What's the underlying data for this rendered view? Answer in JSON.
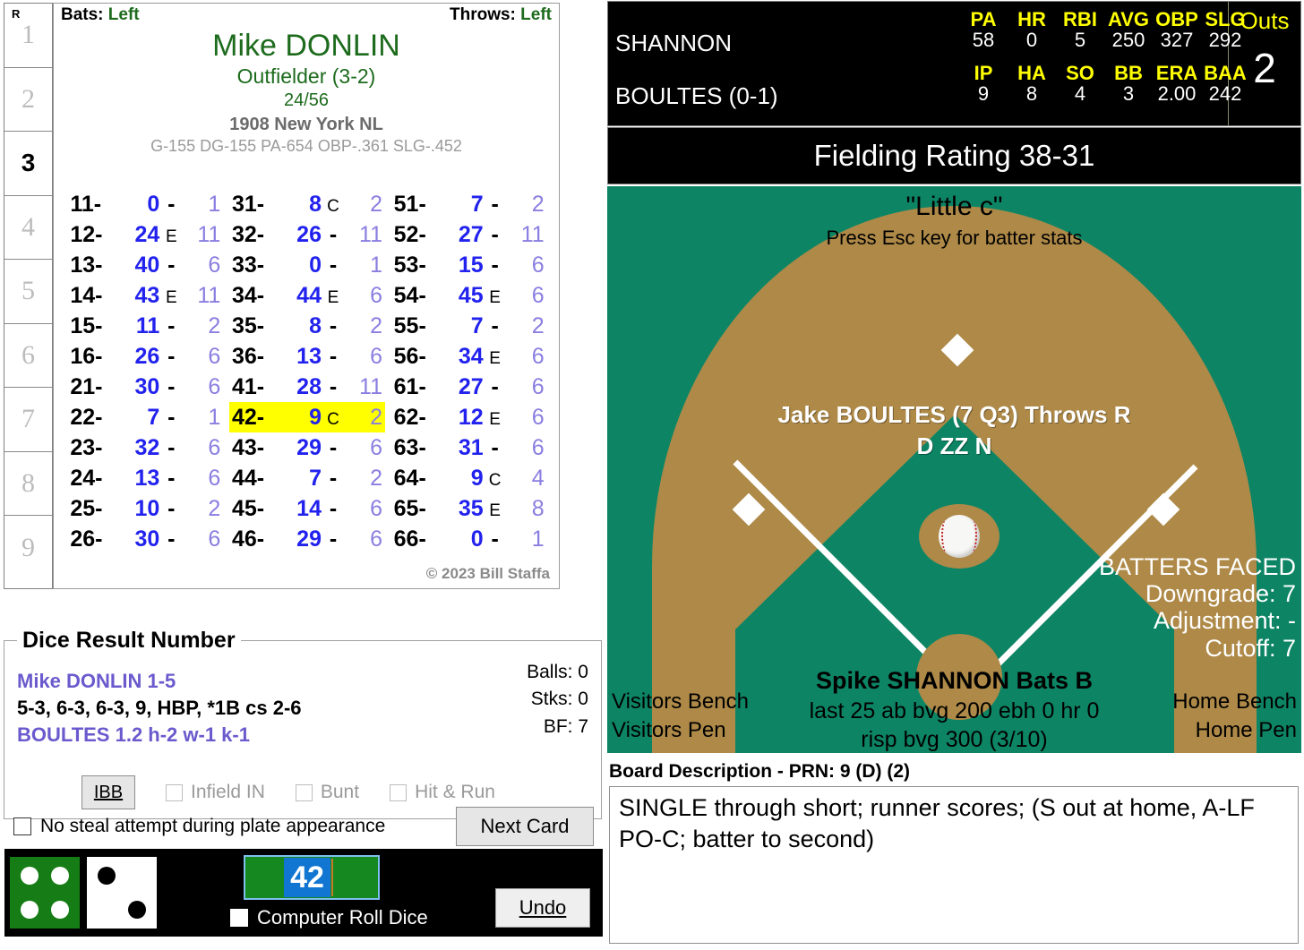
{
  "innings": {
    "runs_header": "R",
    "cells": [
      "1",
      "2",
      "3",
      "4",
      "5",
      "6",
      "7",
      "8",
      "9"
    ],
    "current": "3"
  },
  "batter_card": {
    "bats_label": "Bats:",
    "bats_value": "Left",
    "throws_label": "Throws:",
    "throws_value": "Left",
    "player_name": "Mike DONLIN",
    "position": "Outfielder (3-2)",
    "ratio": "24/56",
    "team": "1908 New York NL",
    "stat_line": "G-155 DG-155 PA-654 OBP-.361 SLG-.452",
    "copyright": "© 2023 Bill Staffa",
    "columns": [
      [
        {
          "key": "11-",
          "num": "0",
          "mid": "-",
          "last": "1",
          "hl": false
        },
        {
          "key": "12-",
          "num": "24",
          "mid": "E",
          "last": "11",
          "hl": false
        },
        {
          "key": "13-",
          "num": "40",
          "mid": "-",
          "last": "6",
          "hl": false
        },
        {
          "key": "14-",
          "num": "43",
          "mid": "E",
          "last": "11",
          "hl": false
        },
        {
          "key": "15-",
          "num": "11",
          "mid": "-",
          "last": "2",
          "hl": false
        },
        {
          "key": "16-",
          "num": "26",
          "mid": "-",
          "last": "6",
          "hl": false
        },
        {
          "key": "21-",
          "num": "30",
          "mid": "-",
          "last": "6",
          "hl": false
        },
        {
          "key": "22-",
          "num": "7",
          "mid": "-",
          "last": "1",
          "hl": false
        },
        {
          "key": "23-",
          "num": "32",
          "mid": "-",
          "last": "6",
          "hl": false
        },
        {
          "key": "24-",
          "num": "13",
          "mid": "-",
          "last": "6",
          "hl": false
        },
        {
          "key": "25-",
          "num": "10",
          "mid": "-",
          "last": "2",
          "hl": false
        },
        {
          "key": "26-",
          "num": "30",
          "mid": "-",
          "last": "6",
          "hl": false
        }
      ],
      [
        {
          "key": "31-",
          "num": "8",
          "mid": "C",
          "last": "2",
          "hl": false
        },
        {
          "key": "32-",
          "num": "26",
          "mid": "-",
          "last": "11",
          "hl": false
        },
        {
          "key": "33-",
          "num": "0",
          "mid": "-",
          "last": "1",
          "hl": false
        },
        {
          "key": "34-",
          "num": "44",
          "mid": "E",
          "last": "6",
          "hl": false
        },
        {
          "key": "35-",
          "num": "8",
          "mid": "-",
          "last": "2",
          "hl": false
        },
        {
          "key": "36-",
          "num": "13",
          "mid": "-",
          "last": "6",
          "hl": false
        },
        {
          "key": "41-",
          "num": "28",
          "mid": "-",
          "last": "11",
          "hl": false
        },
        {
          "key": "42-",
          "num": "9",
          "mid": "C",
          "last": "2",
          "hl": true
        },
        {
          "key": "43-",
          "num": "29",
          "mid": "-",
          "last": "6",
          "hl": false
        },
        {
          "key": "44-",
          "num": "7",
          "mid": "-",
          "last": "2",
          "hl": false
        },
        {
          "key": "45-",
          "num": "14",
          "mid": "-",
          "last": "6",
          "hl": false
        },
        {
          "key": "46-",
          "num": "29",
          "mid": "-",
          "last": "6",
          "hl": false
        }
      ],
      [
        {
          "key": "51-",
          "num": "7",
          "mid": "-",
          "last": "2",
          "hl": false
        },
        {
          "key": "52-",
          "num": "27",
          "mid": "-",
          "last": "11",
          "hl": false
        },
        {
          "key": "53-",
          "num": "15",
          "mid": "-",
          "last": "6",
          "hl": false
        },
        {
          "key": "54-",
          "num": "45",
          "mid": "E",
          "last": "6",
          "hl": false
        },
        {
          "key": "55-",
          "num": "7",
          "mid": "-",
          "last": "2",
          "hl": false
        },
        {
          "key": "56-",
          "num": "34",
          "mid": "E",
          "last": "6",
          "hl": false
        },
        {
          "key": "61-",
          "num": "27",
          "mid": "-",
          "last": "6",
          "hl": false
        },
        {
          "key": "62-",
          "num": "12",
          "mid": "E",
          "last": "6",
          "hl": false
        },
        {
          "key": "63-",
          "num": "31",
          "mid": "-",
          "last": "6",
          "hl": false
        },
        {
          "key": "64-",
          "num": "9",
          "mid": "C",
          "last": "4",
          "hl": false
        },
        {
          "key": "65-",
          "num": "35",
          "mid": "E",
          "last": "8",
          "hl": false
        },
        {
          "key": "66-",
          "num": "0",
          "mid": "-",
          "last": "1",
          "hl": false
        }
      ]
    ]
  },
  "dice_result": {
    "group_title": "Dice Result Number",
    "line1": "Mike DONLIN  1-5",
    "line2": "5-3, 6-3, 6-3, 9, HBP, *1B cs 2-6",
    "line3": "BOULTES  1.2  h-2  w-1  k-1",
    "balls": "Balls: 0",
    "strikes": "Stks: 0",
    "bf": "BF: 7",
    "ibb_label": "IBB",
    "infield_in_label": "Infield IN",
    "bunt_label": "Bunt",
    "hit_and_run_label": "Hit & Run",
    "no_steal_label": "No steal attempt during plate appearance",
    "next_card_label": "Next Card",
    "infield_in_checked": false,
    "bunt_checked": false,
    "hit_and_run_checked": false,
    "no_steal_checked": false
  },
  "dice_widget": {
    "green_die_value": 4,
    "white_die_value": 2,
    "roll_value": "42",
    "computer_roll_label": "Computer Roll Dice",
    "computer_roll_checked": false,
    "undo_label": "Undo"
  },
  "scoreboard": {
    "batter_name": "SHANNON",
    "pitcher_name": "BOULTES (0-1)",
    "batter_headers": [
      "PA",
      "HR",
      "RBI",
      "AVG",
      "OBP",
      "SLG"
    ],
    "batter_values": [
      "58",
      "0",
      "5",
      "250",
      "327",
      "292"
    ],
    "pitcher_headers": [
      "IP",
      "HA",
      "SO",
      "BB",
      "ERA",
      "BAA"
    ],
    "pitcher_values": [
      "9",
      "8",
      "4",
      "3",
      "2.00",
      "242"
    ],
    "outs_label": "Outs",
    "outs_value": "2",
    "fielding_rating": "Fielding Rating 38-31"
  },
  "field": {
    "title": "\"Little c\"",
    "subtitle": "Press Esc key for batter stats",
    "pitcher_line1": "Jake BOULTES (7 Q3) Throws R",
    "pitcher_line2": "D ZZ N",
    "batters_faced_title": "BATTERS FACED",
    "downgrade": "Downgrade: 7",
    "adjustment": "Adjustment: -",
    "cutoff": "Cutoff: 7",
    "batter_line1": "Spike SHANNON Bats B",
    "batter_line2": "last 25 ab bvg 200 ebh 0 hr 0",
    "batter_line3": "risp bvg 300 (3/10)",
    "visitors_bench": "Visitors Bench",
    "visitors_pen": "Visitors Pen",
    "home_bench": "Home Bench",
    "home_pen": "Home Pen"
  },
  "board_description": {
    "title": "Board Description - PRN: 9 (D) (2)",
    "text": "SINGLE through short; runner scores; (S out at home, A-LF PO-C; batter to second)"
  },
  "colors": {
    "field_green": "#0d8565",
    "dirt_brown": "#ae8947",
    "highlight_yellow": "#ffff00",
    "card_green": "#1d6b1d",
    "result_blue": "#2222ee",
    "result_purple": "#8a7ee0",
    "scoreboard_yellow": "#ffff00"
  }
}
